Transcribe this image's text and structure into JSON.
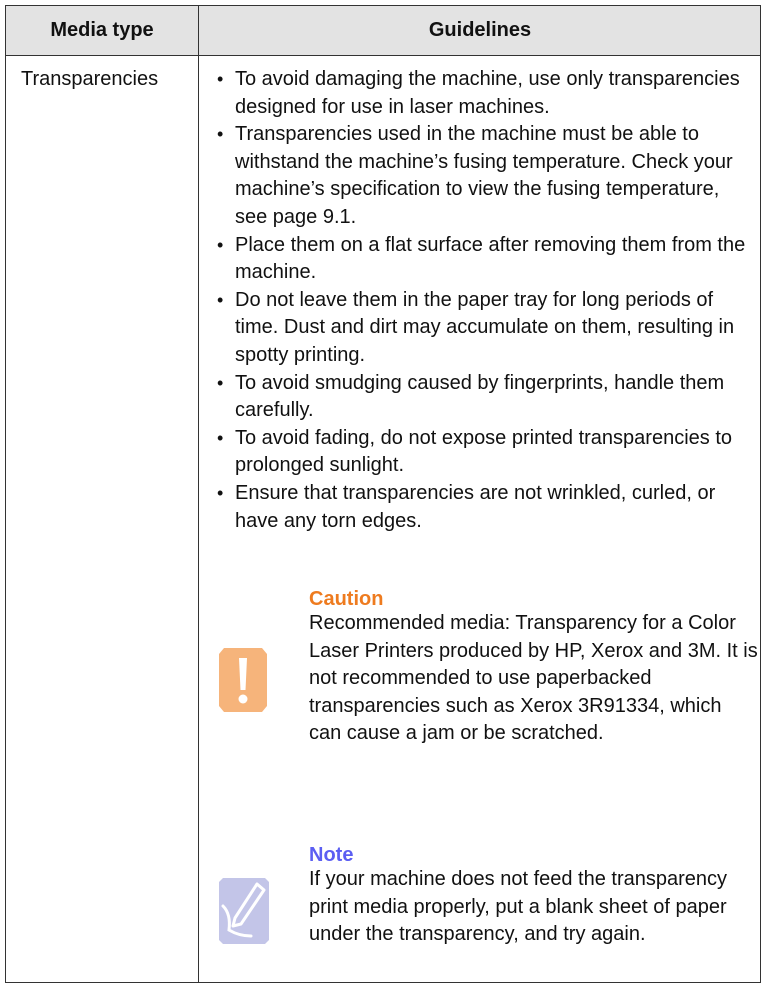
{
  "table": {
    "headers": {
      "media": "Media type",
      "guidelines": "Guidelines"
    },
    "media_type": "Transparencies",
    "guidelines": [
      "To avoid damaging the machine, use only transparencies designed for use in laser machines.",
      "Transparencies used in the machine must be able to withstand the machine’s fusing temperature. Check your machine’s specification to view the fusing temperature, see page 9.1.",
      "Place them on a flat surface after removing them from the machine.",
      "Do not leave them in the paper tray for long periods of time. Dust and dirt may accumulate on them, resulting in spotty printing.",
      "To avoid smudging caused by fingerprints, handle them carefully.",
      "To avoid fading, do not expose printed transparencies to prolonged sunlight.",
      "Ensure that transparencies are not wrinkled, curled, or have any torn edges."
    ]
  },
  "caution": {
    "title": "Caution",
    "text": "Recommended media: Transparency for a Color Laser Printers produced by HP, Xerox and 3M. It is not recommended to use paperbacked transparencies such as Xerox 3R91334, which can cause a jam or be scratched.",
    "icon": "exclamation-icon",
    "color": "#ee7b1f",
    "icon_bg": "#f6b47b"
  },
  "note": {
    "title": "Note",
    "text": "If your machine does not feed the transparency print media properly, put a blank sheet of paper under the transparency, and try again.",
    "icon": "pen-icon",
    "color": "#5b5ef2",
    "icon_bg": "#c3c5e8"
  },
  "colors": {
    "header_bg": "#e3e3e3",
    "border": "#333333"
  }
}
